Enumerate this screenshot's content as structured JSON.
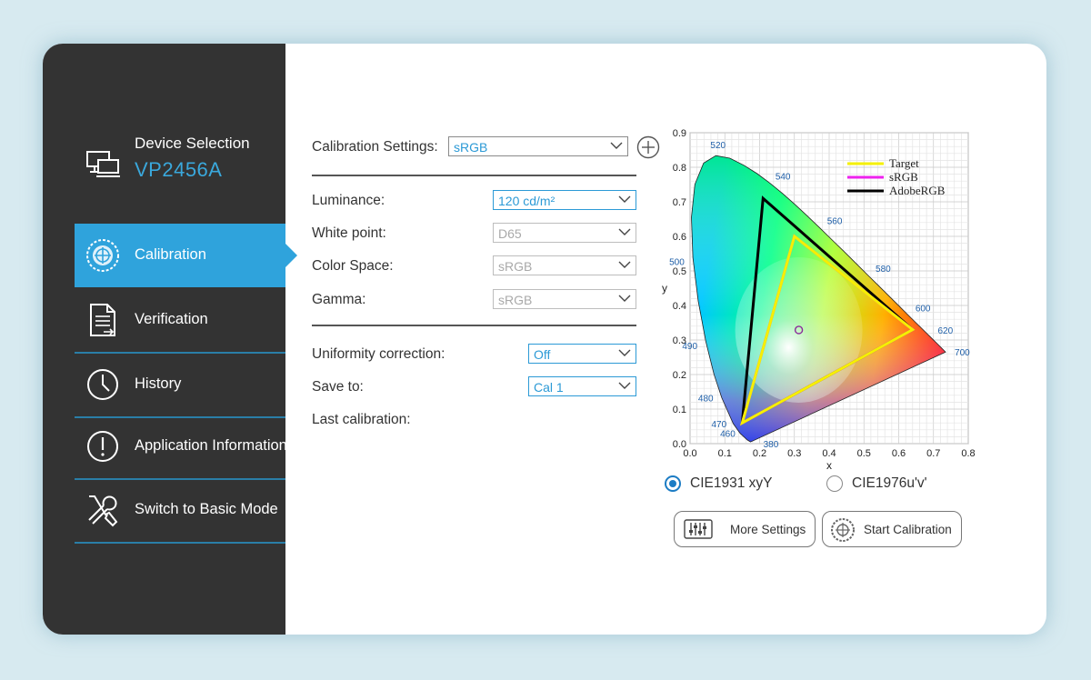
{
  "sidebar": {
    "device": {
      "title": "Device Selection",
      "model": "VP2456A",
      "icon": "monitor-icon"
    },
    "items": [
      {
        "label": "Calibration",
        "icon": "calibration-target-icon",
        "active": true
      },
      {
        "label": "Verification",
        "icon": "document-check-icon",
        "active": false
      },
      {
        "label": "History",
        "icon": "clock-icon",
        "active": false
      },
      {
        "label": "Application Information",
        "icon": "info-exclamation-icon",
        "active": false
      },
      {
        "label": "Switch to Basic Mode",
        "icon": "wrench-screwdriver-icon",
        "active": false
      }
    ]
  },
  "settings": {
    "calibration_settings": {
      "label": "Calibration Settings:",
      "value": "sRGB"
    },
    "luminance": {
      "label": "Luminance:",
      "value": "120 cd/m²"
    },
    "white_point": {
      "label": "White point:",
      "value": "D65"
    },
    "color_space": {
      "label": "Color Space:",
      "value": "sRGB"
    },
    "gamma": {
      "label": "Gamma:",
      "value": "sRGB"
    },
    "uniformity": {
      "label": "Uniformity correction:",
      "value": "Off"
    },
    "save_to": {
      "label": "Save to:",
      "value": "Cal 1"
    },
    "last_calibration": {
      "label": "Last calibration:"
    }
  },
  "chart_data": {
    "type": "scatter",
    "xlabel": "x",
    "ylabel": "y",
    "xlim": [
      0.0,
      0.8
    ],
    "ylim": [
      0.0,
      0.9
    ],
    "x_ticks": [
      "0.0",
      "0.1",
      "0.2",
      "0.3",
      "0.4",
      "0.5",
      "0.6",
      "0.7",
      "0.8"
    ],
    "y_ticks": [
      "0.0",
      "0.1",
      "0.2",
      "0.3",
      "0.4",
      "0.5",
      "0.6",
      "0.7",
      "0.8",
      "0.9"
    ],
    "grid": true,
    "legend_position": "top-right",
    "spectral_locus": [
      [
        0.1741,
        0.005
      ],
      [
        0.1644,
        0.0109
      ],
      [
        0.144,
        0.0297
      ],
      [
        0.1241,
        0.0578
      ],
      [
        0.0913,
        0.1327
      ],
      [
        0.0687,
        0.2007
      ],
      [
        0.0454,
        0.295
      ],
      [
        0.0235,
        0.4127
      ],
      [
        0.0082,
        0.5384
      ],
      [
        0.0039,
        0.6548
      ],
      [
        0.0139,
        0.7502
      ],
      [
        0.0389,
        0.812
      ],
      [
        0.0743,
        0.8338
      ],
      [
        0.1142,
        0.8262
      ],
      [
        0.1547,
        0.8059
      ],
      [
        0.1929,
        0.7816
      ],
      [
        0.2296,
        0.7543
      ],
      [
        0.2658,
        0.7243
      ],
      [
        0.3016,
        0.6923
      ],
      [
        0.3373,
        0.6589
      ],
      [
        0.3731,
        0.6245
      ],
      [
        0.4087,
        0.5896
      ],
      [
        0.4441,
        0.5547
      ],
      [
        0.4788,
        0.5202
      ],
      [
        0.5125,
        0.4866
      ],
      [
        0.5448,
        0.4544
      ],
      [
        0.5752,
        0.4242
      ],
      [
        0.6029,
        0.3965
      ],
      [
        0.627,
        0.3725
      ],
      [
        0.6482,
        0.3514
      ],
      [
        0.6658,
        0.334
      ],
      [
        0.6801,
        0.3197
      ],
      [
        0.6915,
        0.3083
      ],
      [
        0.7006,
        0.2993
      ],
      [
        0.7079,
        0.292
      ],
      [
        0.7347,
        0.2653
      ]
    ],
    "wavelength_labels": [
      {
        "text": "380",
        "x": 0.1741,
        "y": 0.005,
        "ox": 14,
        "oy": 6
      },
      {
        "text": "460",
        "x": 0.144,
        "y": 0.0297,
        "ox": -22,
        "oy": 4
      },
      {
        "text": "470",
        "x": 0.1241,
        "y": 0.0578,
        "ox": -24,
        "oy": 4
      },
      {
        "text": "480",
        "x": 0.0913,
        "y": 0.1327,
        "ox": -26,
        "oy": 4
      },
      {
        "text": "490",
        "x": 0.0454,
        "y": 0.295,
        "ox": -26,
        "oy": 8
      },
      {
        "text": "500",
        "x": 0.0082,
        "y": 0.5384,
        "ox": -26,
        "oy": 8
      },
      {
        "text": "520",
        "x": 0.0743,
        "y": 0.8338,
        "ox": -6,
        "oy": -8
      },
      {
        "text": "540",
        "x": 0.2296,
        "y": 0.7543,
        "ox": 6,
        "oy": -4
      },
      {
        "text": "560",
        "x": 0.3731,
        "y": 0.6245,
        "ox": 8,
        "oy": -4
      },
      {
        "text": "580",
        "x": 0.5125,
        "y": 0.4866,
        "ox": 8,
        "oy": -4
      },
      {
        "text": "600",
        "x": 0.627,
        "y": 0.3725,
        "ox": 8,
        "oy": -4
      },
      {
        "text": "620",
        "x": 0.6915,
        "y": 0.3083,
        "ox": 8,
        "oy": -4
      },
      {
        "text": "700",
        "x": 0.7347,
        "y": 0.2653,
        "ox": 10,
        "oy": 4
      }
    ],
    "series": [
      {
        "name": "Target",
        "color": "#f5f000",
        "points": [
          [
            0.64,
            0.33
          ],
          [
            0.3,
            0.6
          ],
          [
            0.15,
            0.06
          ]
        ]
      },
      {
        "name": "sRGB",
        "color": "#ee22ee",
        "points": [
          [
            0.64,
            0.33
          ],
          [
            0.3,
            0.6
          ],
          [
            0.15,
            0.06
          ]
        ]
      },
      {
        "name": "AdobeRGB",
        "color": "#000000",
        "points": [
          [
            0.64,
            0.33
          ],
          [
            0.21,
            0.71
          ],
          [
            0.15,
            0.06
          ]
        ]
      }
    ],
    "white_point": {
      "x": 0.3127,
      "y": 0.329,
      "color": "#8a2a9a"
    }
  },
  "chart_mode": {
    "options": [
      {
        "label": "CIE1931 xyY",
        "selected": true
      },
      {
        "label": "CIE1976u'v'",
        "selected": false
      }
    ]
  },
  "buttons": {
    "more_settings": "More Settings",
    "start_calibration": "Start Calibration"
  },
  "colors": {
    "accent": "#2fa3dc",
    "sidebar_bg": "#333333",
    "value_text": "#2c9ad6"
  }
}
